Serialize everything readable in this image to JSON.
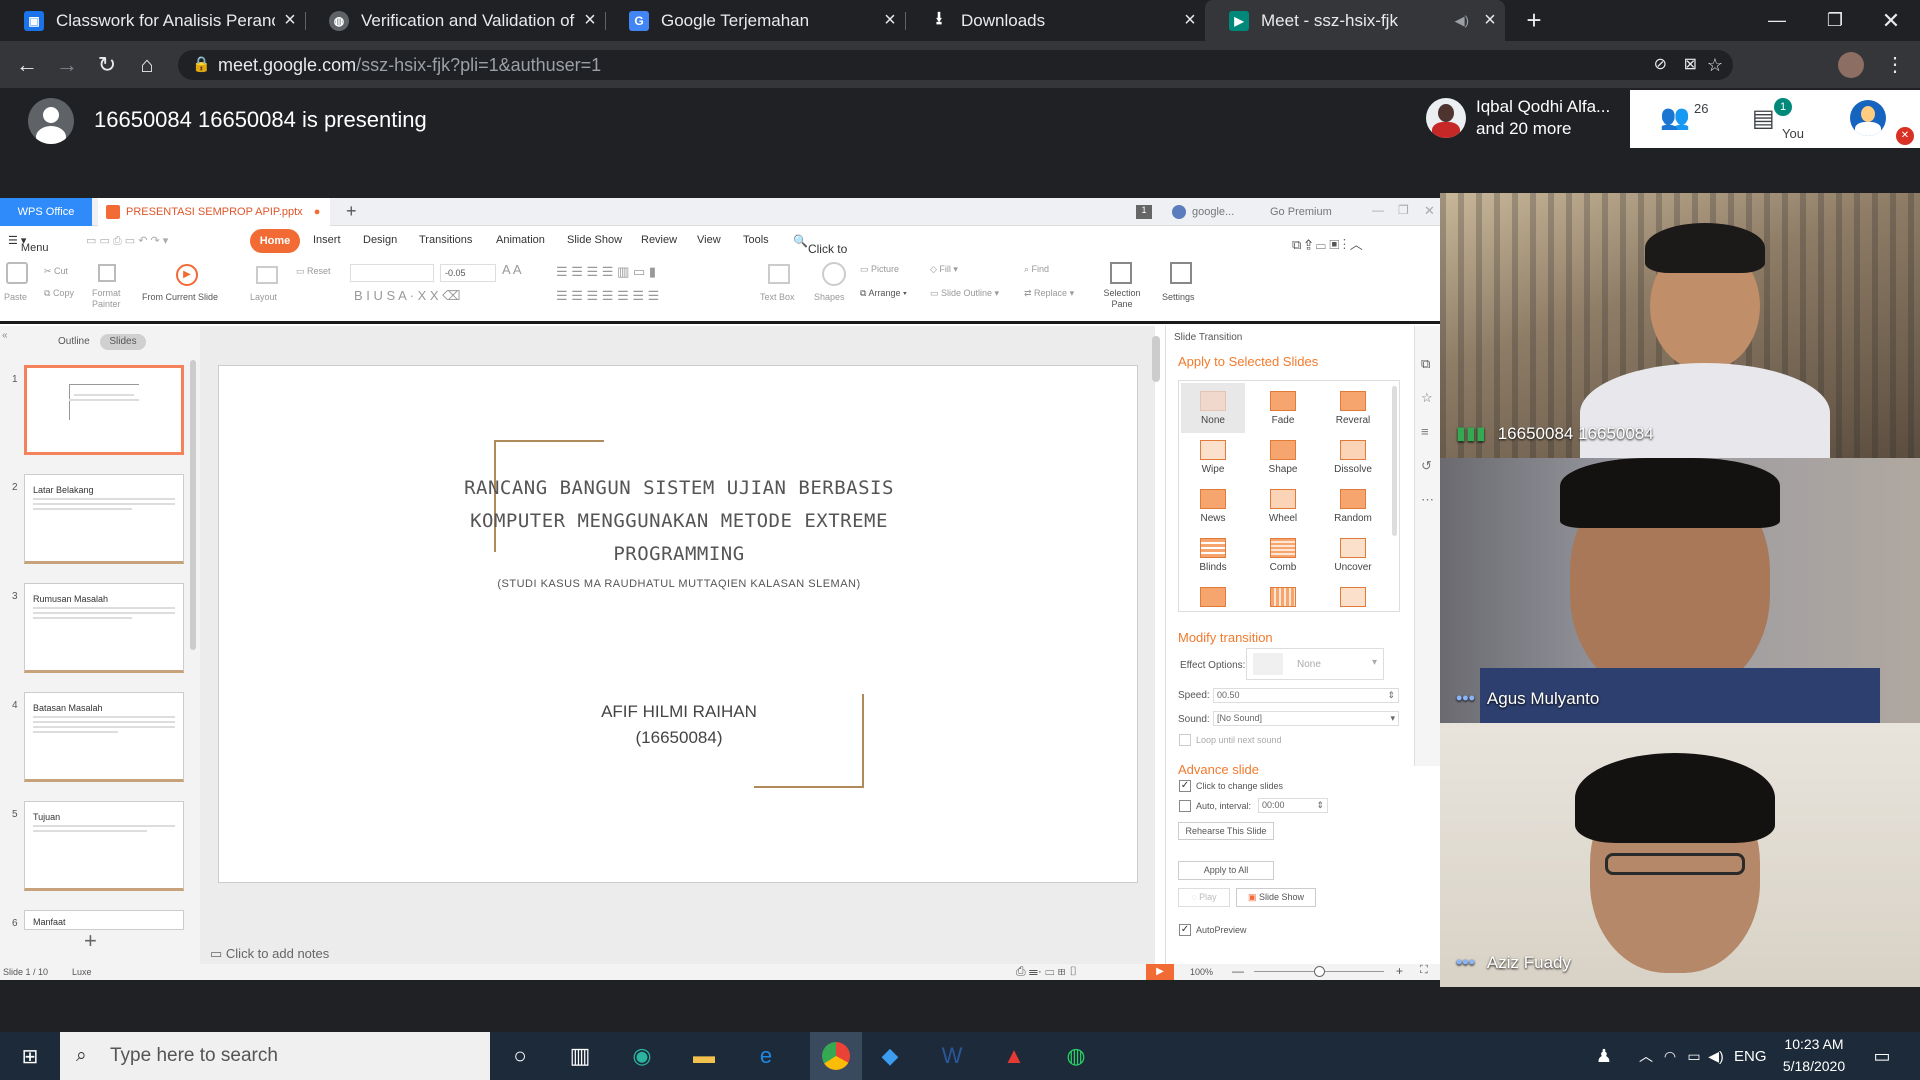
{
  "browser": {
    "tabs": [
      {
        "title": "Classwork for Analisis Perancang",
        "icon": "classroom-icon",
        "color": "#1a73e8"
      },
      {
        "title": "Verification and Validation of UM",
        "icon": "globe-icon",
        "color": "#5f6368"
      },
      {
        "title": "Google Terjemahan",
        "icon": "translate-icon",
        "color": "#4285f4"
      },
      {
        "title": "Downloads",
        "icon": "download-icon",
        "color": "#5f6368"
      },
      {
        "title": "Meet - ssz-hsix-fjk",
        "icon": "meet-icon",
        "color": "#00897b"
      }
    ],
    "url_host": "meet.google.com",
    "url_path": "/ssz-hsix-fjk?pli=1&authuser=1"
  },
  "meet": {
    "presenting_text": "16650084 16650084 is presenting",
    "participant_name": "Iqbal Qodhi Alfa...",
    "participant_more": "and 20 more",
    "people_count": "26",
    "chat_badge": "1",
    "you_label": "You",
    "videos": [
      {
        "name": "16650084 16650084",
        "speaking": true
      },
      {
        "name": "Agus Mulyanto",
        "speaking": false
      },
      {
        "name": "Aziz Fuady",
        "speaking": false
      }
    ]
  },
  "wps": {
    "app_tab": "WPS Office",
    "doc_tab": "PRESENTASI SEMPROP APIP.pptx",
    "account": "google...",
    "premium": "Go Premium",
    "menu_items": [
      "Menu",
      "Home",
      "Insert",
      "Design",
      "Transitions",
      "Animation",
      "Slide Show",
      "Review",
      "View",
      "Tools"
    ],
    "find_commands": "Click to find commands",
    "ribbon": {
      "paste": "Paste",
      "cut": "Cut",
      "copy": "Copy",
      "format_painter": "Format Painter",
      "from_current": "From Current Slide",
      "layout": "Layout",
      "reset": "Reset",
      "font_size": "-0.05",
      "text_box": "Text Box",
      "shapes": "Shapes",
      "picture": "Picture",
      "arrange": "Arrange",
      "fill": "Fill",
      "slide_outline": "Slide Outline",
      "find": "Find",
      "replace": "Replace",
      "selection_pane": "Selection Pane",
      "settings": "Settings"
    },
    "pane_tabs": [
      "Outline",
      "Slides"
    ],
    "thumbnails": [
      {
        "num": "1",
        "title": ""
      },
      {
        "num": "2",
        "title": "Latar Belakang"
      },
      {
        "num": "3",
        "title": "Rumusan Masalah"
      },
      {
        "num": "4",
        "title": "Batasan Masalah"
      },
      {
        "num": "5",
        "title": "Tujuan"
      },
      {
        "num": "6",
        "title": "Manfaat"
      }
    ],
    "slide": {
      "title_lines": [
        "RANCANG BANGUN SISTEM UJIAN  BERBASIS",
        "KOMPUTER  MENGGUNAKAN  METODE EXTREME",
        "PROGRAMMING"
      ],
      "subtitle": "(STUDI KASUS MA RAUDHATUL MUTTAQIEN KALASAN SLEMAN)",
      "author": "AFIF HILMI RAIHAN",
      "author_id": "(16650084)"
    },
    "notes_placeholder": "Click to add notes",
    "status_slide": "Slide 1 / 10",
    "status_theme": "Luxe",
    "zoom": "100%",
    "transition": {
      "panel_title": "Slide Transition",
      "apply_selected": "Apply to Selected Slides",
      "effects": [
        "None",
        "Fade",
        "Reveral",
        "Wipe",
        "Shape",
        "Dissolve",
        "News",
        "Wheel",
        "Random",
        "Blinds",
        "Comb",
        "Uncover",
        "",
        "",
        ""
      ],
      "modify": "Modify transition",
      "effect_options_label": "Effect Options:",
      "effect_options_value": "None",
      "speed_label": "Speed:",
      "speed_value": "00.50",
      "sound_label": "Sound:",
      "sound_value": "[No Sound]",
      "loop": "Loop until next sound",
      "advance": "Advance slide",
      "click_change": "Click to change slides",
      "auto_interval": "Auto, interval:",
      "interval_value": "00:00",
      "rehearse": "Rehearse This Slide",
      "apply_all": "Apply to All",
      "play": "Play",
      "slide_show": "Slide Show",
      "autopreview": "AutoPreview"
    }
  },
  "taskbar": {
    "search_placeholder": "Type here to search",
    "lang": "ENG",
    "time": "10:23 AM",
    "date": "5/18/2020"
  }
}
